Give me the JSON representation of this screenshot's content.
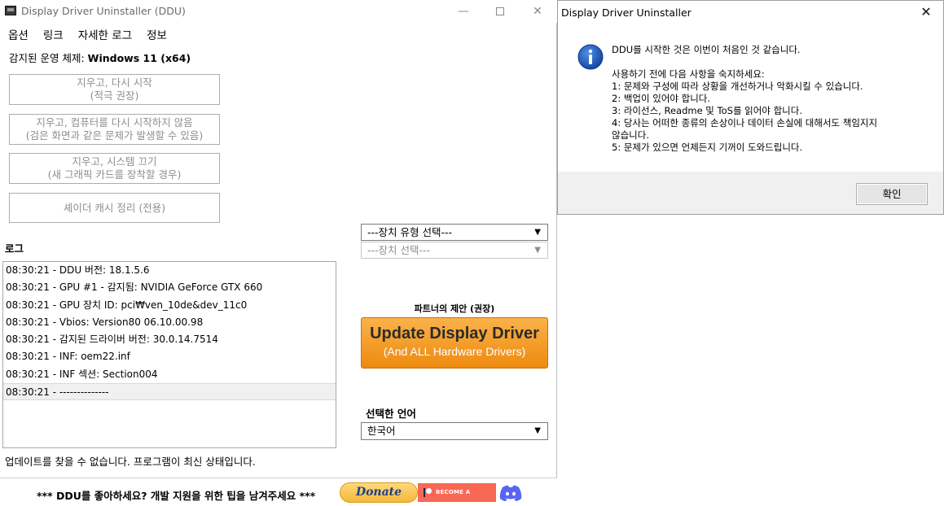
{
  "main_window": {
    "title": "Display Driver Uninstaller (DDU)",
    "menu": [
      "옵션",
      "링크",
      "자세한 로그",
      "정보"
    ],
    "os_label": "감지된 운영 체제:",
    "os_value": "Windows 11 (x64)",
    "buttons": [
      {
        "line1": "지우고, 다시 시작",
        "line2": "(적극 권장)"
      },
      {
        "line1": "지우고, 컴퓨터를 다시 시작하지 않음",
        "line2": "(검은 화면과 같은 문제가 발생할 수 있음)"
      },
      {
        "line1": "지우고, 시스템 끄기",
        "line2": "(새 그래픽 카드를 장착할 경우)"
      },
      {
        "line1": "셰이더 캐시 정리 (전용)"
      }
    ],
    "log_label": "로그",
    "log_entries": [
      "08:30:21 - DDU 버전: 18.1.5.6",
      "08:30:21 - GPU #1 - 감지됨: NVIDIA GeForce GTX 660",
      "08:30:21 - GPU 장치 ID: pci₩ven_10de&dev_11c0",
      "08:30:21 - Vbios: Version80 06.10.00.98",
      "08:30:21 - 감지된 드라이버 버전: 30.0.14.7514",
      "08:30:21 - INF: oem22.inf",
      "08:30:21 - INF 섹션: Section004",
      "08:30:21 - --------------"
    ],
    "status": "업데이트를 찾을 수 없습니다. 프로그램이 최신 상태입니다.",
    "device_type_select": "---장치 유형 선택---",
    "device_select": "---장치 선택---",
    "partner_label": "파트너의 제안 (권장)",
    "update_main": "Update Display Driver",
    "update_sub": "(And ALL Hardware Drivers)",
    "language_label": "선택한 언어",
    "language_value": "한국어",
    "tip_text": "*** DDU를 좋아하세요? 개발 지원을 위한 팁을 남겨주세요 ***",
    "donate_label": "Donate",
    "patron_label": "BECOME A PATRON"
  },
  "dialog": {
    "title": "Display Driver Uninstaller",
    "line_first": "DDU를 시작한 것은 이번이 처음인 것 같습니다.",
    "lines": [
      "사용하기 전에 다음 사항을 숙지하세요:",
      "1: 문제와 구성에 따라 상황을 개선하거나 악화시킬 수 있습니다.",
      "2: 백업이 있어야 합니다.",
      "3: 라이선스, Readme 및 ToS를 읽어야 합니다.",
      "4: 당사는 어떠한 종류의 손상이나 데이터 손실에 대해서도 책임지지",
      "않습니다.",
      "5: 문제가 있으면 언제든지 기꺼이 도와드립니다."
    ],
    "ok_label": "확인"
  },
  "colors": {
    "update_orange": "#f39a22",
    "patreon": "#f96854",
    "discord": "#5865f2",
    "info_blue": "#1f5fbf"
  },
  "icons": [
    "app-icon",
    "minimize-icon",
    "maximize-icon",
    "close-icon",
    "dropdown-arrow-icon",
    "info-icon",
    "patreon-icon",
    "discord-icon"
  ]
}
